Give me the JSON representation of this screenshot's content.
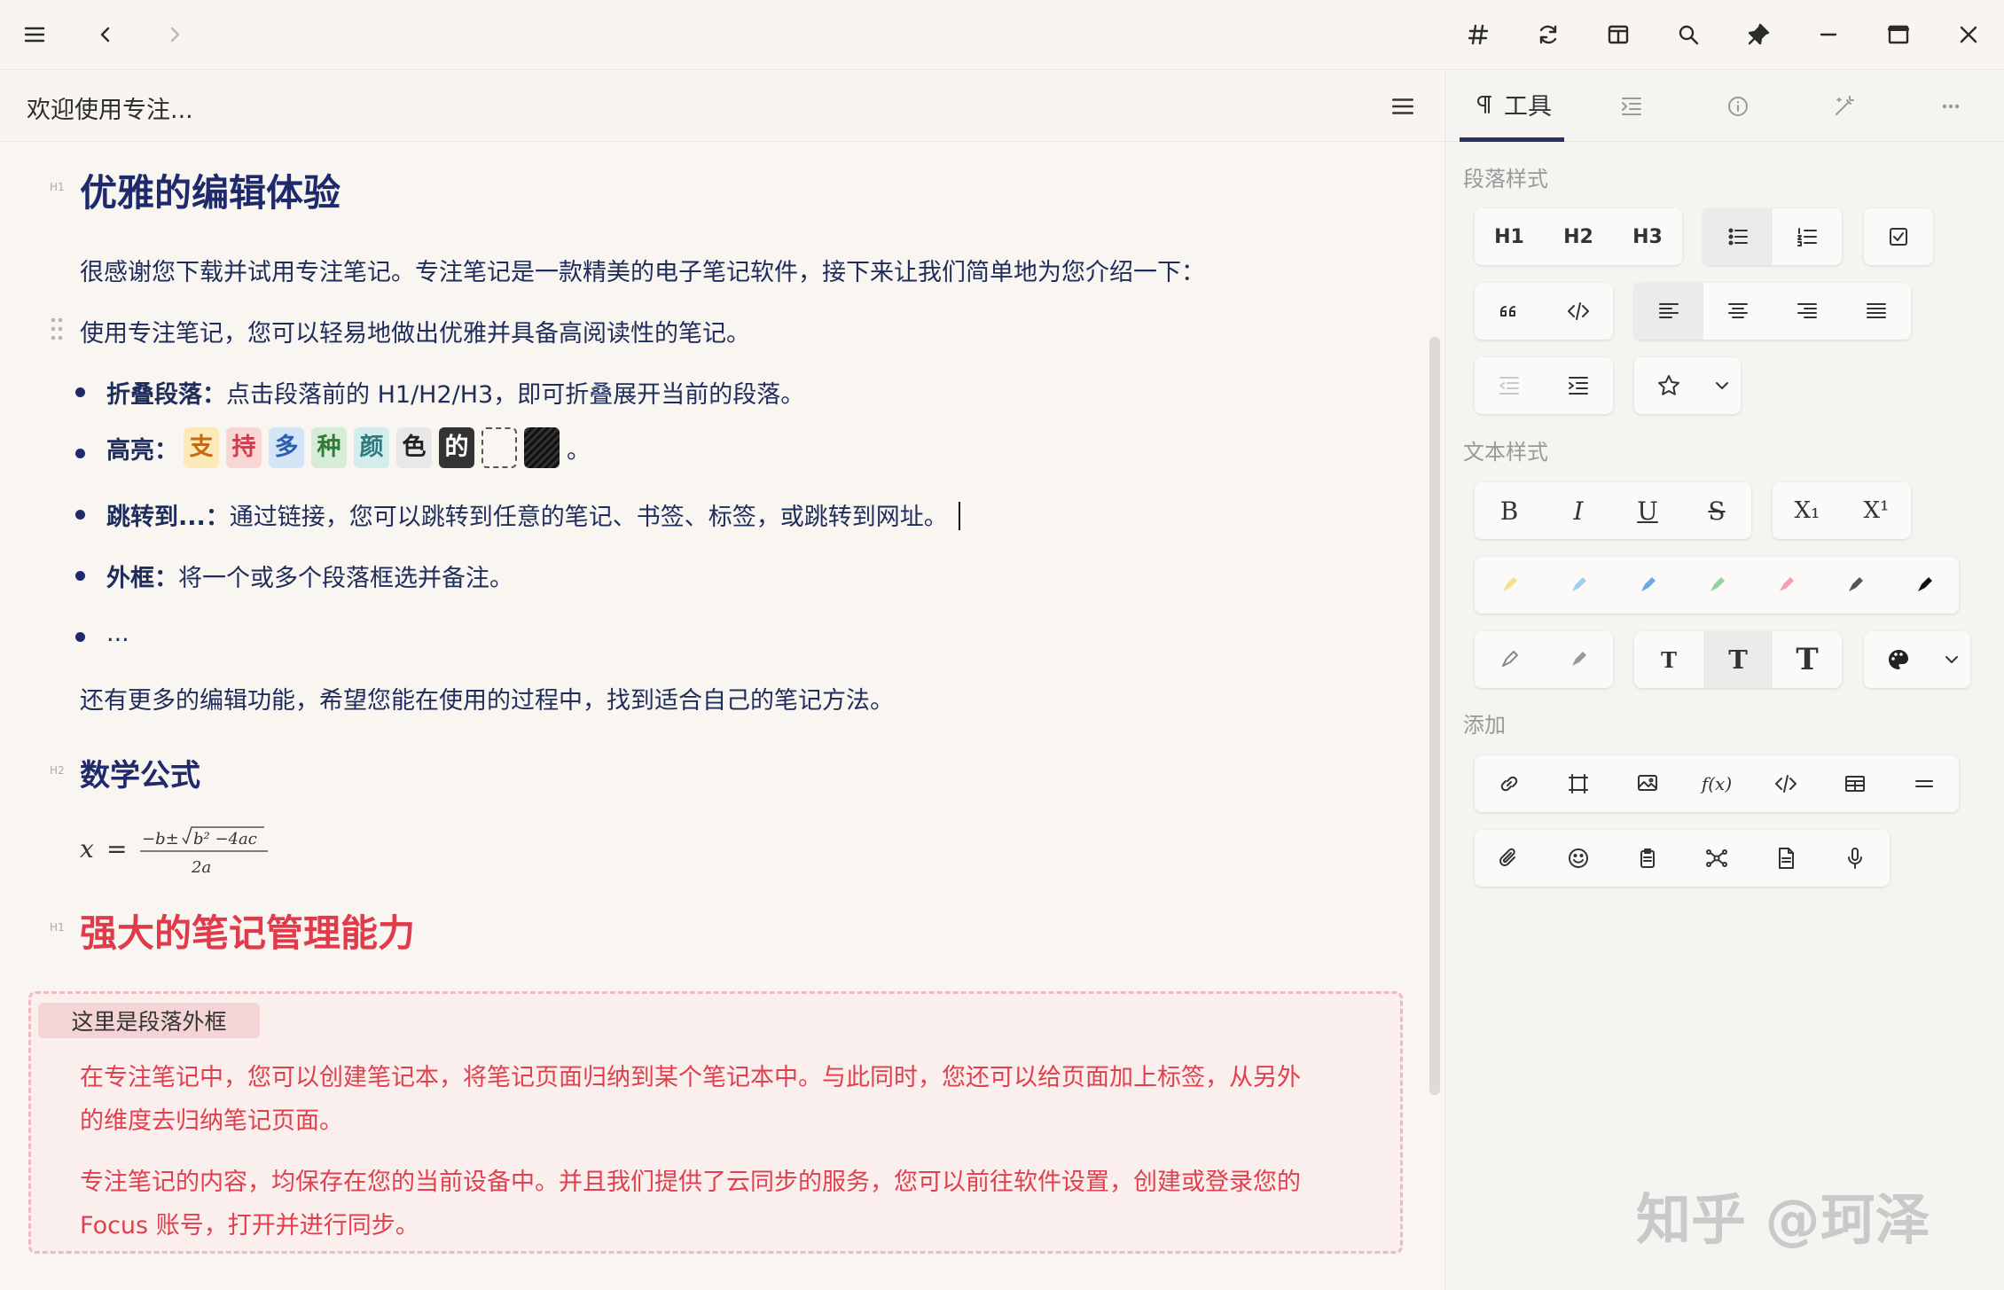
{
  "doc": {
    "title": "欢迎使用专注..."
  },
  "editor": {
    "h1_edit": "优雅的编辑体验",
    "intro": "很感谢您下载并试用专注笔记。专注笔记是一款精美的电子笔记软件，接下来让我们简单地为您介绍一下：",
    "intro2": "使用专注笔记，您可以轻易地做出优雅并具备高阅读性的笔记。",
    "fold_label": "折叠段落：",
    "fold_text": "点击段落前的 H1/H2/H3，即可折叠展开当前的段落。",
    "hl_label": "高亮：",
    "hl_chars": [
      "支",
      "持",
      "多",
      "种",
      "颜",
      "色",
      "的"
    ],
    "hl_end": "。",
    "jump_label": "跳转到...：",
    "jump_text": "通过链接，您可以跳转到任意的笔记、书签、标签，或跳转到网址。",
    "border_label": "外框：",
    "border_text": "将一个或多个段落框选并备注。",
    "ellipsis": "...",
    "more": "还有更多的编辑功能，希望您能在使用的过程中，找到适合自己的笔记方法。",
    "h2_math": "数学公式",
    "h1_manage": "强大的笔记管理能力",
    "frame_label": "这里是段落外框",
    "red1a": "在专注笔记中，您可以创建笔记本，将笔记页面归纳到某个笔记本中。与此同时，您还可以给页面加上标签，从另外",
    "red1b": "的维度去归纳笔记页面。",
    "red2a": "专注笔记的内容，均保存在您的当前设备中。并且我们提供了云同步的服务，您可以前往软件设置，创建或登录您的",
    "red2b": "Focus 账号，打开并进行同步。",
    "hmarks": {
      "h1": "H1",
      "h2": "H2"
    }
  },
  "panel": {
    "tab_tools": "工具",
    "sec_paragraph": "段落样式",
    "sec_text": "文本样式",
    "sec_add": "添加",
    "h1": "H1",
    "h2": "H2",
    "h3": "H3",
    "bold": "B",
    "italic": "I",
    "underline": "U",
    "strike": "S",
    "sub": "X₁",
    "sup": "X¹",
    "t_small": "T",
    "t_mid": "T",
    "t_big": "T",
    "fx": "f(x)"
  },
  "colors": {
    "highlights": [
      "#fbe9b8",
      "#f9d6d6",
      "#d4e5f7",
      "#d7ecd6",
      "#d3ecec",
      "#e8e8e8",
      "#333333"
    ],
    "pens": [
      "#f5e08a",
      "#9fd0f0",
      "#6aa8e8",
      "#95d39d",
      "#f3a3ad",
      "#555555",
      "#111111"
    ]
  },
  "watermark": "知乎 @珂泽"
}
